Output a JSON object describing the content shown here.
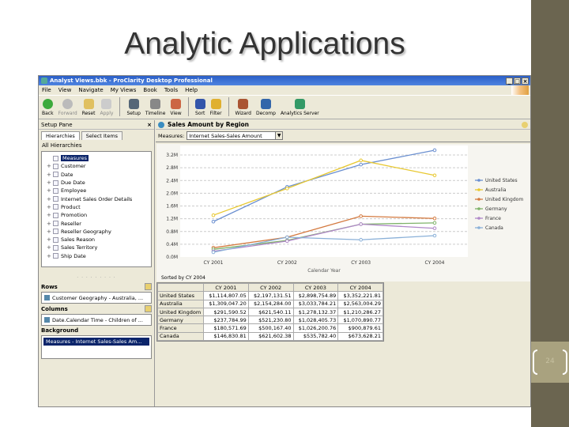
{
  "slide": {
    "title": "Analytic Applications",
    "page_number": "24"
  },
  "window": {
    "title": "Analyst Views.bbk - ProClarity Desktop Professional",
    "buttons": [
      "_",
      "□",
      "×"
    ]
  },
  "menu": [
    "File",
    "View",
    "Navigate",
    "My Views",
    "Book",
    "Tools",
    "Help"
  ],
  "toolbar": [
    {
      "label": "Back",
      "icon": "back-arrow-icon",
      "color": "#3caa3c",
      "disabled": false
    },
    {
      "label": "Forward",
      "icon": "forward-arrow-icon",
      "color": "#bbbbbb",
      "disabled": true
    },
    {
      "label": "Reset",
      "icon": "reset-icon",
      "color": "#e0c060",
      "disabled": false
    },
    {
      "label": "Apply",
      "icon": "apply-icon",
      "color": "#cccccc",
      "disabled": true
    },
    {
      "label": "Setup",
      "icon": "setup-icon",
      "color": "#556677",
      "disabled": false
    },
    {
      "label": "Timeline",
      "icon": "timeline-icon",
      "color": "#888888",
      "disabled": false
    },
    {
      "label": "View",
      "icon": "view-icon",
      "color": "#cc6644",
      "disabled": false
    },
    {
      "label": "Sort",
      "icon": "sort-icon",
      "color": "#3355aa",
      "disabled": false
    },
    {
      "label": "Filter",
      "icon": "filter-icon",
      "color": "#e0b030",
      "disabled": false
    },
    {
      "label": "Wizard",
      "icon": "wizard-icon",
      "color": "#aa5533",
      "disabled": false
    },
    {
      "label": "Decomp",
      "icon": "decomp-icon",
      "color": "#3366aa",
      "disabled": false
    },
    {
      "label": "Analytics Server",
      "icon": "analytics-server-icon",
      "color": "#339966",
      "disabled": false
    }
  ],
  "setup_pane": {
    "title": "Setup Pane",
    "close": "×",
    "tabs": [
      "Hierarchies",
      "Select Items"
    ],
    "root": "All Hierarchies",
    "tree": [
      "Measures",
      "Customer",
      "Date",
      "Due Date",
      "Employee",
      "Internet Sales Order Details",
      "Product",
      "Promotion",
      "Reseller",
      "Reseller Geography",
      "Sales Reason",
      "Sales Territory",
      "Ship Date"
    ],
    "rows_label": "Rows",
    "rows_value": "Customer Geography - Australia, ...",
    "columns_label": "Columns",
    "columns_value": "Date.Calendar Time - Children of ...",
    "background_label": "Background",
    "background_value": "Measures - Internet Sales-Sales Am..."
  },
  "view": {
    "title": "Sales Amount by Region",
    "measures_label": "Measures:",
    "measures_value": "Internet Sales-Sales Amount",
    "sorted_by": "Sorted by CY 2004"
  },
  "chart_data": {
    "type": "line",
    "title": "Sales Amount by Region",
    "xlabel": "Calendar Year",
    "ylabel": "",
    "categories": [
      "CY 2001",
      "CY 2002",
      "CY 2003",
      "CY 2004"
    ],
    "yticks": [
      "0.0M",
      "0.4M",
      "0.8M",
      "1.2M",
      "1.6M",
      "2.0M",
      "2.4M",
      "2.8M",
      "3.2M"
    ],
    "ylim": [
      0,
      3.2
    ],
    "grid": true,
    "legend_position": "right",
    "series": [
      {
        "name": "United States",
        "color": "#6a8fd0",
        "values": [
          1.11,
          2.2,
          2.9,
          3.35
        ]
      },
      {
        "name": "Australia",
        "color": "#e8c830",
        "values": [
          1.31,
          2.15,
          3.03,
          2.56
        ]
      },
      {
        "name": "United Kingdom",
        "color": "#d47a40",
        "values": [
          0.29,
          0.62,
          1.28,
          1.21
        ]
      },
      {
        "name": "Germany",
        "color": "#7fb36a",
        "values": [
          0.24,
          0.52,
          1.03,
          1.07
        ]
      },
      {
        "name": "France",
        "color": "#b088c8",
        "values": [
          0.18,
          0.5,
          1.03,
          0.9
        ]
      },
      {
        "name": "Canada",
        "color": "#8ab0d8",
        "values": [
          0.15,
          0.62,
          0.54,
          0.67
        ]
      }
    ]
  },
  "grid": {
    "columns": [
      "CY 2001",
      "CY 2002",
      "CY 2003",
      "CY 2004"
    ],
    "rows": [
      {
        "label": "United States",
        "values": [
          "$1,114,807.05",
          "$2,197,131.51",
          "$2,898,754.89",
          "$3,352,221.81"
        ]
      },
      {
        "label": "Australia",
        "values": [
          "$1,309,047.20",
          "$2,154,284.00",
          "$3,033,784.21",
          "$2,563,004.29"
        ]
      },
      {
        "label": "United Kingdom",
        "values": [
          "$291,590.52",
          "$621,540.11",
          "$1,278,132.37",
          "$1,210,286.27"
        ]
      },
      {
        "label": "Germany",
        "values": [
          "$237,784.99",
          "$521,230.80",
          "$1,028,405.73",
          "$1,070,890.77"
        ]
      },
      {
        "label": "France",
        "values": [
          "$180,571.69",
          "$500,167.40",
          "$1,026,200.76",
          "$900,879.61"
        ]
      },
      {
        "label": "Canada",
        "values": [
          "$146,830.81",
          "$621,602.38",
          "$535,782.40",
          "$673,628.21"
        ]
      }
    ]
  }
}
